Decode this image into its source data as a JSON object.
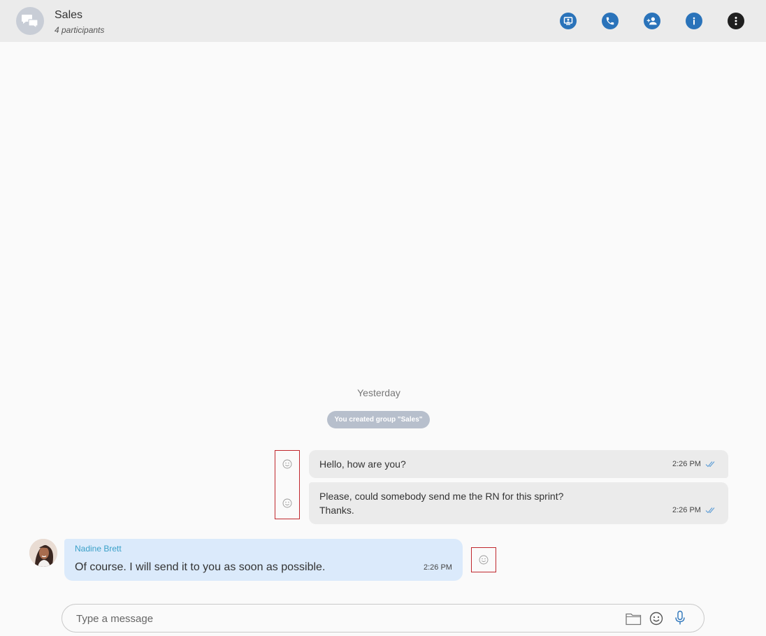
{
  "header": {
    "title": "Sales",
    "subtitle": "4 participants",
    "actions": [
      "screen-share",
      "call",
      "add-participant",
      "info",
      "more"
    ]
  },
  "conversation": {
    "date_separator": "Yesterday",
    "system_message": "You created group \"Sales\"",
    "messages": [
      {
        "direction": "outgoing",
        "text": "Hello, how are you?",
        "time": "2:26 PM",
        "status": "read"
      },
      {
        "direction": "outgoing",
        "line1": "Please, could somebody send me the RN for this sprint?",
        "line2": "Thanks.",
        "time": "2:26 PM",
        "status": "read"
      },
      {
        "direction": "incoming",
        "sender": "Nadine Brett",
        "text": "Of course. I will send it to you as soon as possible.",
        "time": "2:26 PM"
      }
    ]
  },
  "composer": {
    "placeholder": "Type a message",
    "value": ""
  },
  "colors": {
    "accent": "#2a73ba",
    "header_bg": "#ebebeb",
    "outgoing_bubble": "#ebebeb",
    "incoming_bubble": "#dbeafb",
    "sender_name": "#3aa0c8",
    "highlight_border": "#c0272d"
  }
}
